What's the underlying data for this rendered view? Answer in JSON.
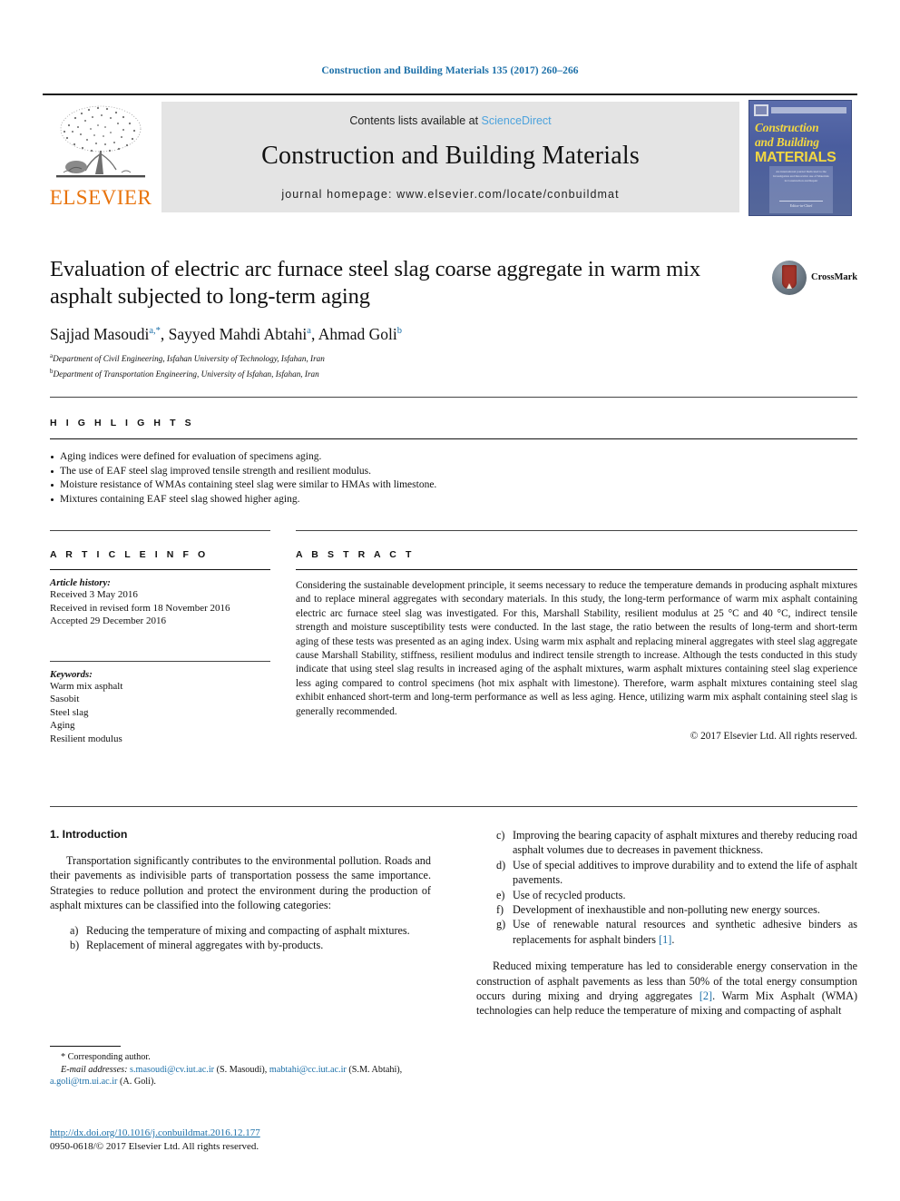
{
  "running_head": "Construction and Building Materials 135 (2017) 260–266",
  "masthead": {
    "elsevier_wordmark": "ELSEVIER",
    "contents_prefix": "Contents lists available at ",
    "sciencedirect": "ScienceDirect",
    "journal_title": "Construction and Building Materials",
    "homepage": "journal homepage: www.elsevier.com/locate/conbuildmat",
    "cover": {
      "line1": "Construction",
      "line2": "and Building",
      "line3": "MATERIALS",
      "blurb": "An international journal Dedicated to the Investigation and Innovative use of Materials in Construction and Repair",
      "foot": "Editor-in-Chief"
    }
  },
  "article": {
    "title": "Evaluation of electric arc furnace steel slag coarse aggregate in warm mix asphalt subjected to long-term aging",
    "authors": [
      {
        "name": "Sajjad Masoudi",
        "marks": "a,*"
      },
      {
        "name": "Sayyed Mahdi Abtahi",
        "marks": "a"
      },
      {
        "name": "Ahmad Goli",
        "marks": "b"
      }
    ],
    "affiliations": [
      {
        "mark": "a",
        "text": "Department of Civil Engineering, Isfahan University of Technology, Isfahan, Iran"
      },
      {
        "mark": "b",
        "text": "Department of Transportation Engineering, University of Isfahan, Isfahan, Iran"
      }
    ],
    "crossmark_label": "CrossMark"
  },
  "highlights": {
    "heading": "H I G H L I G H T S",
    "items": [
      "Aging indices were defined for evaluation of specimens aging.",
      "The use of EAF steel slag improved tensile strength and resilient modulus.",
      "Moisture resistance of WMAs containing steel slag were similar to HMAs with limestone.",
      "Mixtures containing EAF steel slag showed higher aging."
    ]
  },
  "article_info": {
    "heading": "A R T I C L E   I N F O",
    "history_label": "Article history:",
    "history": [
      "Received 3 May 2016",
      "Received in revised form 18 November 2016",
      "Accepted 29 December 2016"
    ],
    "keywords_label": "Keywords:",
    "keywords": [
      "Warm mix asphalt",
      "Sasobit",
      "Steel slag",
      "Aging",
      "Resilient modulus"
    ]
  },
  "abstract": {
    "heading": "A B S T R A C T",
    "text": "Considering the sustainable development principle, it seems necessary to reduce the temperature demands in producing asphalt mixtures and to replace mineral aggregates with secondary materials. In this study, the long-term performance of warm mix asphalt containing electric arc furnace steel slag was investigated. For this, Marshall Stability, resilient modulus at 25 °C and 40 °C, indirect tensile strength and moisture susceptibility tests were conducted. In the last stage, the ratio between the results of long-term and short-term aging of these tests was presented as an aging index. Using warm mix asphalt and replacing mineral aggregates with steel slag aggregate cause Marshall Stability, stiffness, resilient modulus and indirect tensile strength to increase. Although the tests conducted in this study indicate that using steel slag results in increased aging of the asphalt mixtures, warm asphalt mixtures containing steel slag experience less aging compared to control specimens (hot mix asphalt with limestone). Therefore, warm asphalt mixtures containing steel slag exhibit enhanced short-term and long-term performance as well as less aging. Hence, utilizing warm mix asphalt containing steel slag is generally recommended.",
    "copyright": "© 2017 Elsevier Ltd. All rights reserved."
  },
  "body": {
    "section_title": "1. Introduction",
    "para1": "Transportation significantly contributes to the environmental pollution. Roads and their pavements as indivisible parts of transportation possess the same importance. Strategies to reduce pollution and protect the environment during the production of asphalt mixtures can be classified into the following categories:",
    "list_left": [
      {
        "marker": "a)",
        "text": "Reducing the temperature of mixing and compacting of asphalt mixtures."
      },
      {
        "marker": "b)",
        "text": "Replacement of mineral aggregates with by-products."
      }
    ],
    "list_right": [
      {
        "marker": "c)",
        "text": "Improving the bearing capacity of asphalt mixtures and thereby reducing road asphalt volumes due to decreases in pavement thickness."
      },
      {
        "marker": "d)",
        "text": "Use of special additives to improve durability and to extend the life of asphalt pavements."
      },
      {
        "marker": "e)",
        "text": "Use of recycled products."
      },
      {
        "marker": "f)",
        "text": "Development of inexhaustible and non-polluting new energy sources."
      },
      {
        "marker": "g)",
        "text": "Use of renewable natural resources and synthetic adhesive binders as replacements for asphalt binders ",
        "ref": "[1]",
        "tail": "."
      }
    ],
    "para2_a": "Reduced mixing temperature has led to considerable energy conservation in the construction of asphalt pavements as less than 50% of the total energy consumption occurs during mixing and drying aggregates ",
    "para2_ref": "[2]",
    "para2_b": ". Warm Mix Asphalt (WMA) technologies can help reduce the temperature of mixing and compacting of asphalt"
  },
  "footnote": {
    "corresponding": "* Corresponding author.",
    "email_label": "E-mail addresses:",
    "email1": "s.masoudi@cv.iut.ac.ir",
    "email1_who": " (S. Masoudi), ",
    "email2": "mabtahi@cc.iut.ac.ir",
    "email2_who": " (S.M. Abtahi), ",
    "email3": "a.goli@trn.ui.ac.ir",
    "email3_who": " (A. Goli)."
  },
  "doi": {
    "url": "http://dx.doi.org/10.1016/j.conbuildmat.2016.12.177",
    "issn_line": "0950-0618/© 2017 Elsevier Ltd. All rights reserved."
  },
  "colors": {
    "link_blue": "#1b6fa8",
    "sciencedirect_blue": "#4da3dd",
    "elsevier_orange": "#e8730c",
    "banner_gray": "#e4e4e4",
    "cover_blue": "#46599c",
    "cover_yellow": "#f2d742"
  }
}
